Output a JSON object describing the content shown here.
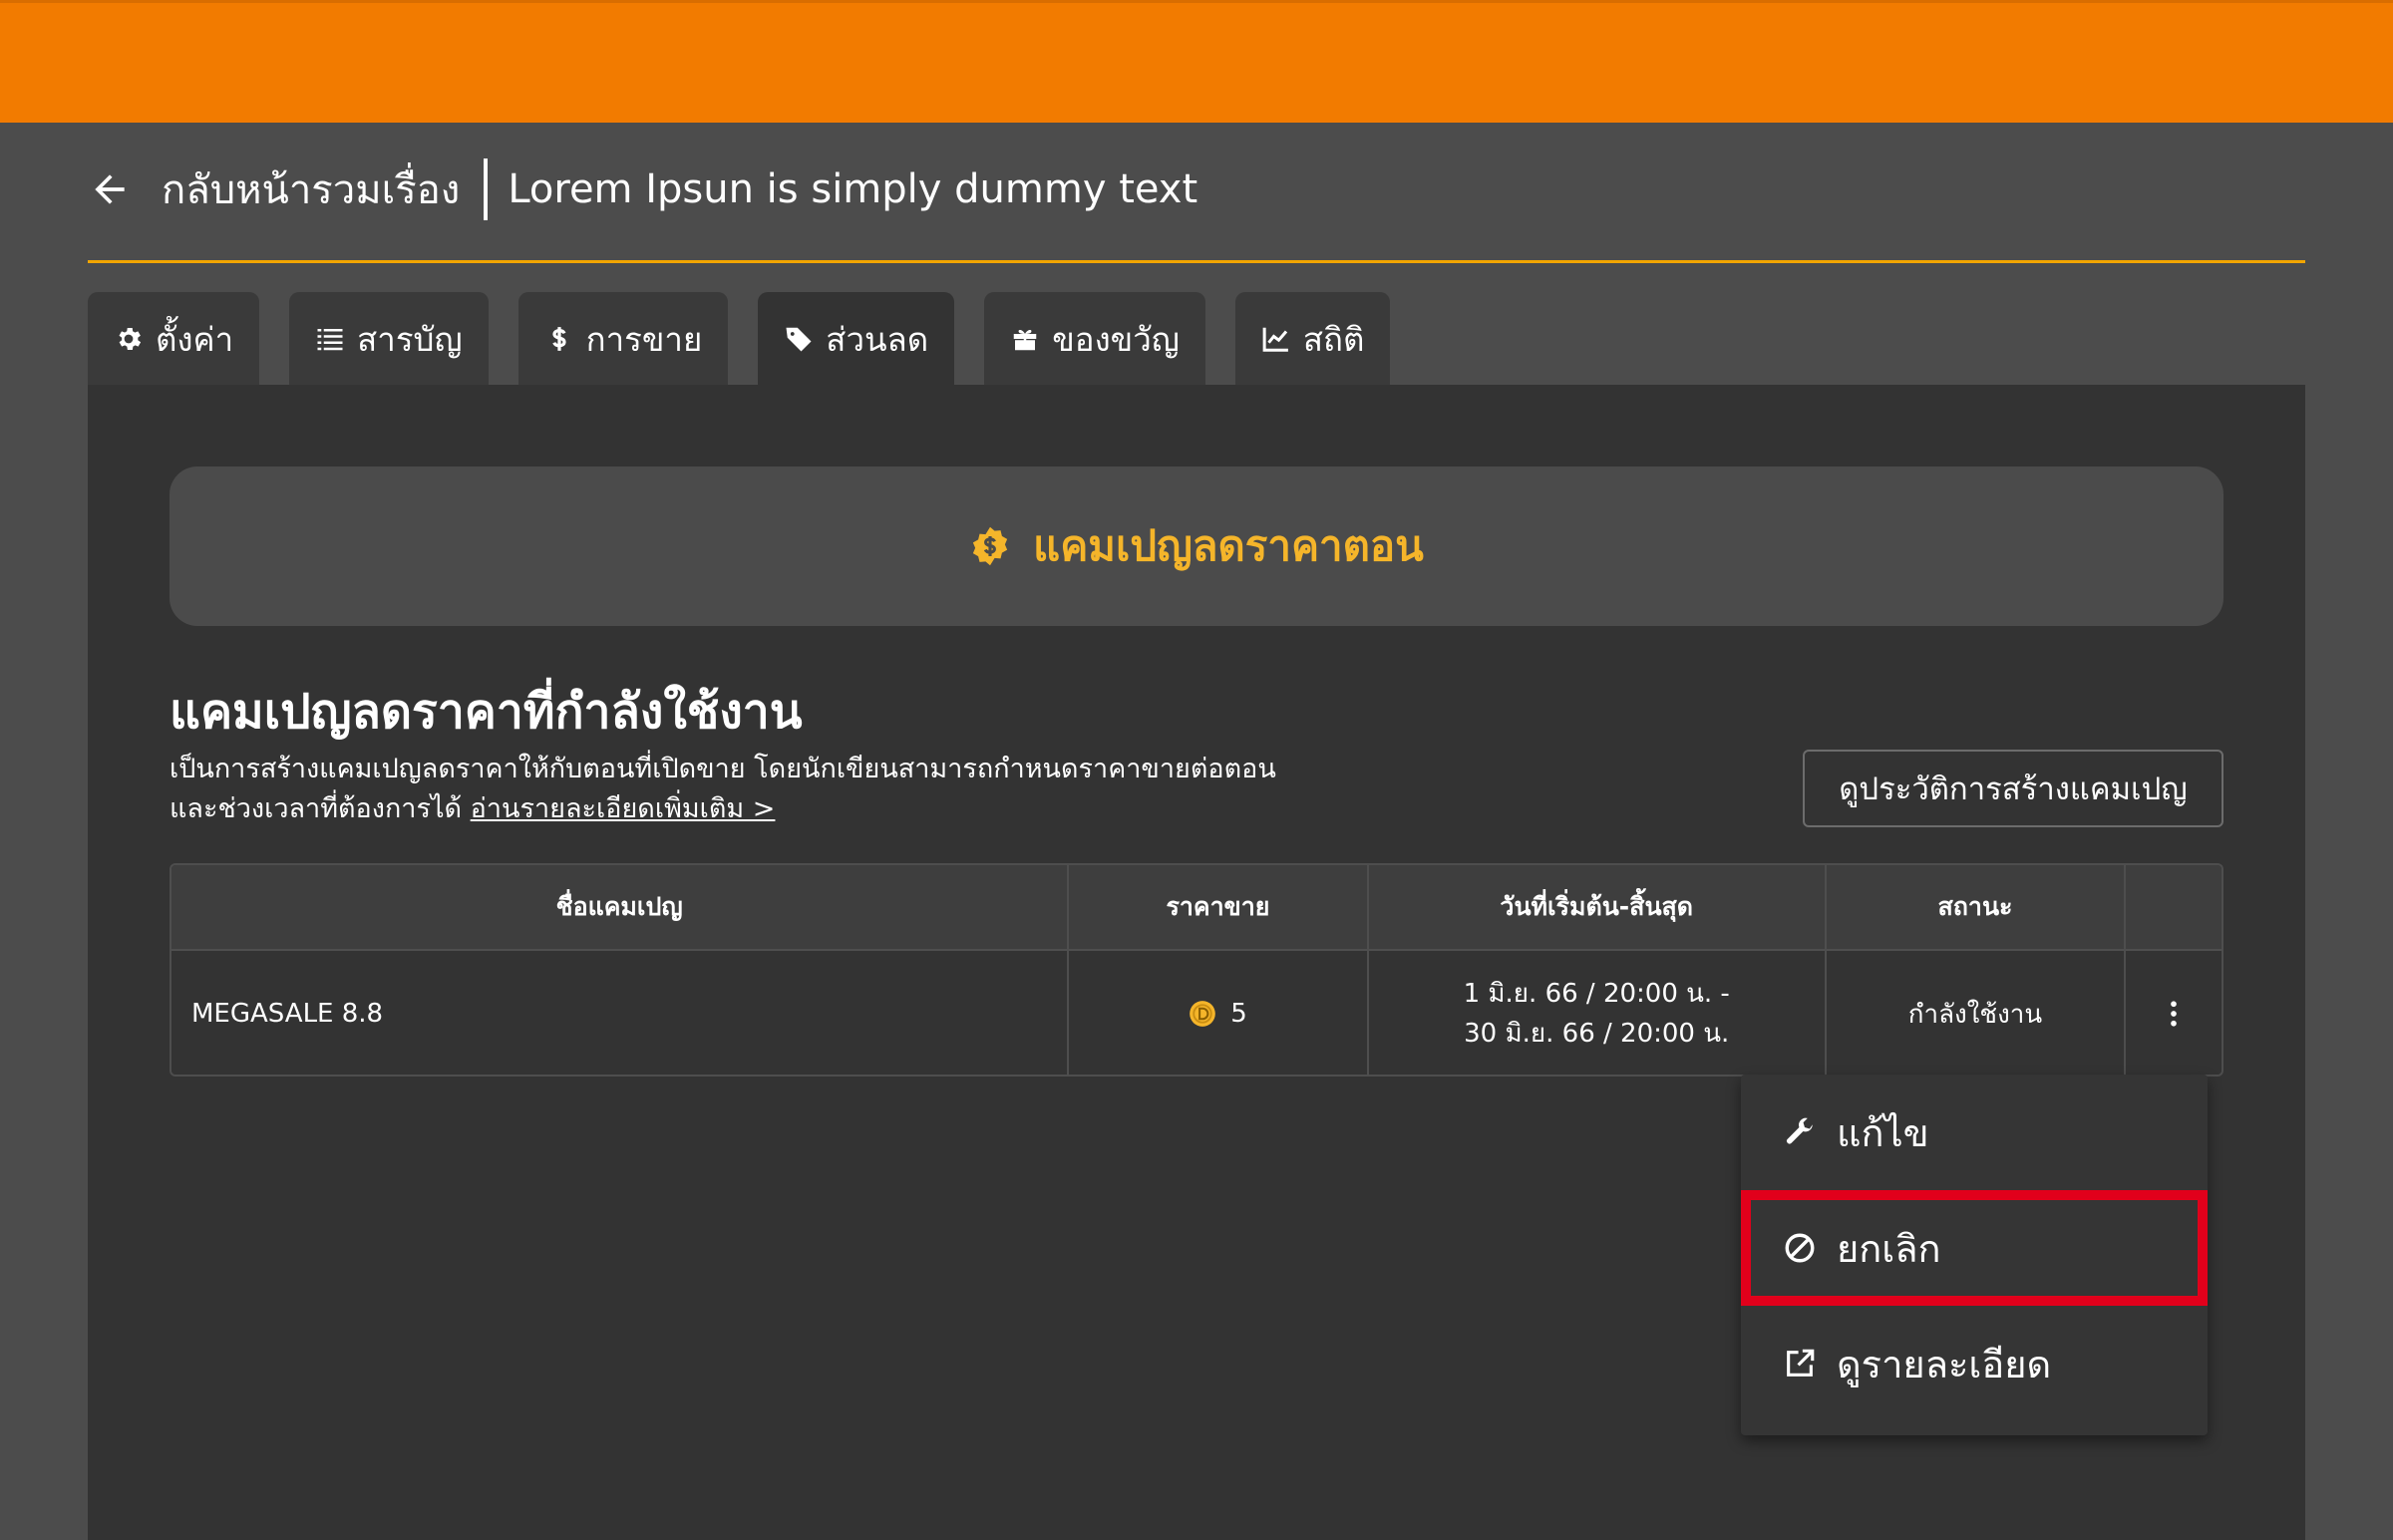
{
  "colors": {
    "topbar": "#f27b00",
    "accent": "#f2a500",
    "banner_text": "#f5b52a",
    "highlight_border": "#e1001b"
  },
  "header": {
    "back_icon": "arrow-left-icon",
    "back_label": "กลับหน้ารวมเรื่อง",
    "title": "Lorem Ipsun is simply dummy text"
  },
  "tabs": [
    {
      "label": "ตั้งค่า",
      "icon": "gear-icon"
    },
    {
      "label": "สารบัญ",
      "icon": "list-icon"
    },
    {
      "label": "การขาย",
      "icon": "dollar-icon"
    },
    {
      "label": "ส่วนลด",
      "icon": "tag-icon",
      "active": true
    },
    {
      "label": "ของขวัญ",
      "icon": "gift-icon"
    },
    {
      "label": "สถิติ",
      "icon": "chart-line-icon"
    }
  ],
  "banner": {
    "icon": "discount-badge-icon",
    "title": "แคมเปญลดราคาตอน"
  },
  "section": {
    "title": "แคมเปญลดราคาที่กำลังใช้งาน",
    "desc_line1": "เป็นการสร้างแคมเปญลดราคาให้กับตอนที่เปิดขาย โดยนักเขียนสามารถกำหนดราคาขายต่อตอน",
    "desc_line2": "และช่วงเวลาที่ต้องการได้",
    "read_more": "อ่านรายละเอียดเพิ่มเติม >",
    "history_button": "ดูประวัติการสร้างแคมเปญ"
  },
  "table": {
    "headers": [
      "ชื่อแคมเปญ",
      "ราคาขาย",
      "วันที่เริ่มต้น-สิ้นสุด",
      "สถานะ"
    ],
    "rows": [
      {
        "name": "MEGASALE 8.8",
        "price": "5",
        "price_icon": "coin-icon",
        "date_start": "1 มิ.ย. 66 / 20:00 น. -",
        "date_end": "30 มิ.ย. 66 / 20:00 น.",
        "status": "กำลังใช้งาน"
      }
    ]
  },
  "menu": {
    "edit": {
      "label": "แก้ไข",
      "icon": "wrench-icon"
    },
    "cancel": {
      "label": "ยกเลิก",
      "icon": "ban-icon"
    },
    "detail": {
      "label": "ดูรายละเอียด",
      "icon": "external-link-icon"
    }
  }
}
